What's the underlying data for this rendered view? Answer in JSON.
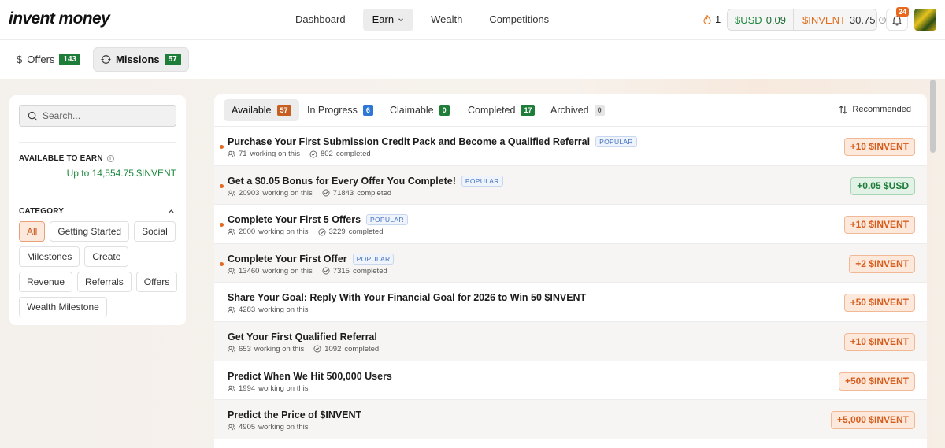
{
  "brand": {
    "logo": "invent money"
  },
  "nav": {
    "links": [
      "Dashboard",
      "Earn",
      "Wealth",
      "Competitions"
    ],
    "active": "Earn"
  },
  "header": {
    "streak": "1",
    "wallet": {
      "usd_label": "$USD",
      "usd_value": "0.09",
      "invent_label": "$INVENT",
      "invent_value": "30.75"
    },
    "notifications": "24"
  },
  "subnav": {
    "offers_label": "Offers",
    "offers_count": "143",
    "missions_label": "Missions",
    "missions_count": "57"
  },
  "sidebar": {
    "search_placeholder": "Search...",
    "available_label": "AVAILABLE TO EARN",
    "available_value": "Up to 14,554.75 $INVENT",
    "category_label": "CATEGORY",
    "categories": [
      "All",
      "Getting Started",
      "Social",
      "Milestones",
      "Create",
      "Revenue",
      "Referrals",
      "Offers",
      "Wealth Milestone"
    ],
    "active_category": "All"
  },
  "tabs": [
    {
      "label": "Available",
      "count": "57",
      "color": "orange"
    },
    {
      "label": "In Progress",
      "count": "6",
      "color": "blue"
    },
    {
      "label": "Claimable",
      "count": "0",
      "color": "green"
    },
    {
      "label": "Completed",
      "count": "17",
      "color": "green"
    },
    {
      "label": "Archived",
      "count": "0",
      "color": "grey"
    }
  ],
  "sort_label": "Recommended",
  "missions": [
    {
      "title": "Purchase Your First Submission Credit Pack and Become a Qualified Referral",
      "popular": true,
      "working": "71",
      "completed": "802",
      "reward": "+10 $INVENT",
      "reward_color": "orange",
      "dot": true
    },
    {
      "title": "Get a $0.05 Bonus for Every Offer You Complete!",
      "popular": true,
      "working": "20903",
      "completed": "71843",
      "reward": "+0.05 $USD",
      "reward_color": "green",
      "dot": true
    },
    {
      "title": "Complete Your First 5 Offers",
      "popular": true,
      "working": "2000",
      "completed": "3229",
      "reward": "+10 $INVENT",
      "reward_color": "orange",
      "dot": true
    },
    {
      "title": "Complete Your First Offer",
      "popular": true,
      "working": "13460",
      "completed": "7315",
      "reward": "+2 $INVENT",
      "reward_color": "orange",
      "dot": true
    },
    {
      "title": "Share Your Goal: Reply With Your Financial Goal for 2026 to Win 50 $INVENT",
      "popular": false,
      "working": "4283",
      "completed": null,
      "reward": "+50 $INVENT",
      "reward_color": "orange",
      "dot": false
    },
    {
      "title": "Get Your First Qualified Referral",
      "popular": false,
      "working": "653",
      "completed": "1092",
      "reward": "+10 $INVENT",
      "reward_color": "orange",
      "dot": false
    },
    {
      "title": "Predict When We Hit 500,000 Users",
      "popular": false,
      "working": "1994",
      "completed": null,
      "reward": "+500 $INVENT",
      "reward_color": "orange",
      "dot": false
    },
    {
      "title": "Predict the Price of $INVENT",
      "popular": false,
      "working": "4905",
      "completed": null,
      "reward": "+5,000 $INVENT",
      "reward_color": "orange",
      "dot": false
    }
  ],
  "labels": {
    "popular": "POPULAR",
    "working_suffix": "working on this",
    "completed_suffix": "completed"
  }
}
